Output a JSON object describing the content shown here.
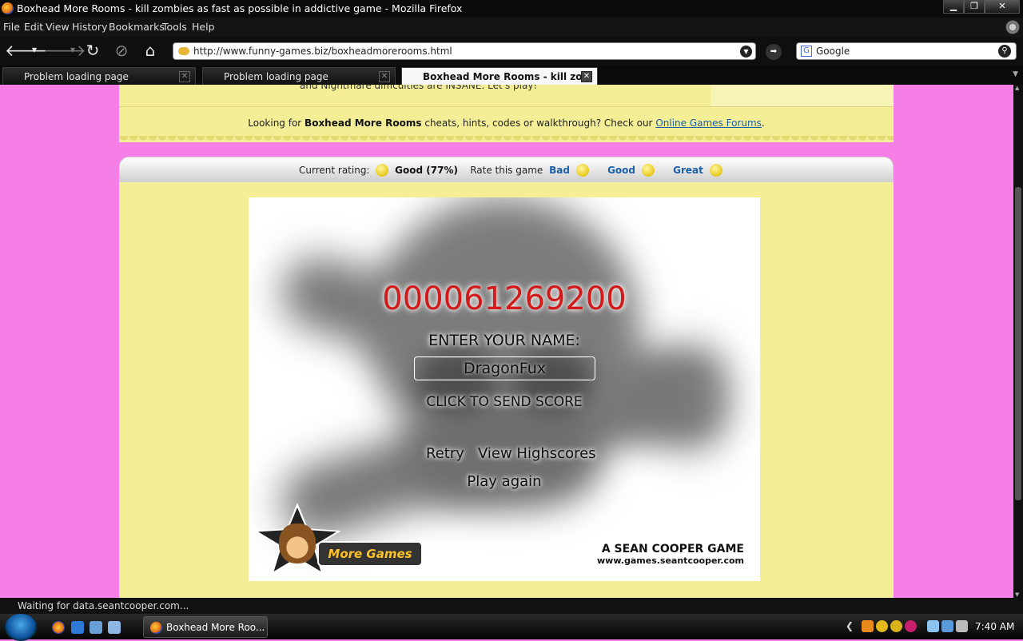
{
  "window": {
    "title": "Boxhead More Rooms - kill zombies as fast as possible in addictive game - Mozilla Firefox",
    "buttons": {
      "minimize": "▁",
      "maximize": "❐",
      "close": "✕"
    }
  },
  "menu": [
    "File",
    "Edit",
    "View",
    "History",
    "Bookmarks",
    "Tools",
    "Help"
  ],
  "nav": {
    "back": "🡐",
    "forward": "🡒",
    "reload": "↻",
    "stop": "⊘",
    "home": "⌂",
    "url": "http://www.funny-games.biz/boxheadmorerooms.html",
    "go": "➡",
    "search_value": "Google",
    "search_engine_letter": "G"
  },
  "tabs": [
    {
      "label": "Problem loading page",
      "active": false
    },
    {
      "label": "Problem loading page",
      "active": false
    },
    {
      "label": "Boxhead More Rooms - kill zo...",
      "active": true
    }
  ],
  "page": {
    "cut_text": "and Nightmare difficulties are INSANE. Let's play!",
    "forum_prefix": "Looking for ",
    "forum_game": "Boxhead More Rooms",
    "forum_mid": " cheats, hints, codes or walkthrough? Check our ",
    "forum_link": "Online Games Forums",
    "forum_suffix": ".",
    "rating_label": "Current rating:",
    "rating_value": "Good (77%)",
    "rate_label": "Rate this game",
    "rate_bad": "Bad",
    "rate_good": "Good",
    "rate_great": "Great"
  },
  "game": {
    "score": "000061269200",
    "name_label": "ENTER YOUR NAME:",
    "name_value": "DragonFux",
    "send_score": "CLICK TO SEND SCORE",
    "retry": "Retry",
    "view_highscores": "View Highscores",
    "play_again": "Play again",
    "more_games": "More Games",
    "credit_line1": "A SEAN COOPER GAME",
    "credit_line2": "www.games.seantcooper.com"
  },
  "status": {
    "text": "Waiting for data.seantcooper.com..."
  },
  "taskbar": {
    "task_label": "Boxhead More Roo...",
    "clock": "7:40 AM",
    "tray_arrow": "❮"
  },
  "colors": {
    "page_bg": "#f57fe6",
    "panel_bg": "#f4ef97",
    "score_red": "#d21a1a",
    "link_blue": "#1a5fa8"
  }
}
